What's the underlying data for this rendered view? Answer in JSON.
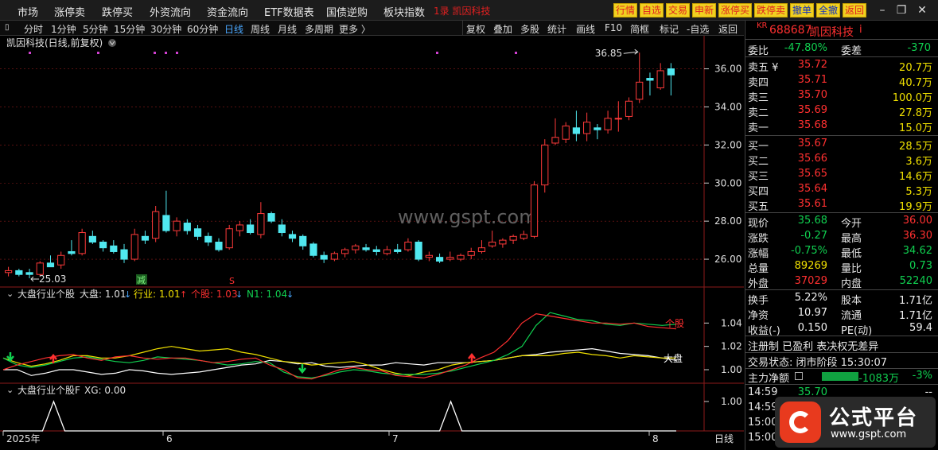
{
  "menu": {
    "items": [
      "市场",
      "涨停卖",
      "跌停买",
      "外资流向",
      "资金流向",
      "ETF数据表",
      "国债逆购",
      "板块指数"
    ],
    "stock_tag": "1录 凯因科技",
    "toolbar_buttons": [
      "行情",
      "自选",
      "交易",
      "申新",
      "涨停买",
      "跌停卖",
      "撤单",
      "全撤",
      "返回"
    ]
  },
  "period_bar": {
    "left_items": [
      "分时",
      "1分钟",
      "5分钟",
      "15分钟",
      "30分钟",
      "60分钟",
      "日线",
      "周线",
      "月线",
      "多周期",
      "更多 〉"
    ],
    "active": "日线",
    "right_items": [
      "复权",
      "叠加",
      "多股",
      "统计",
      "画线",
      "F10",
      "简框",
      "标记",
      "-自选",
      "返回"
    ]
  },
  "chart": {
    "main_title": "凯因科技(日线,前复权)",
    "price_ticks": [
      "36.00",
      "34.00",
      "32.00",
      "30.00",
      "28.00",
      "26.00"
    ],
    "high_label": "36.85",
    "low_label": "25.03",
    "watermark": "www.gspt.com",
    "sub1_title": "大盘行业个股",
    "sub1_values": {
      "dapan": "大盘: 1.01",
      "hangye": "行业: 1.01",
      "gegu": "个股: 1.03",
      "n1": "N1: 1.04"
    },
    "sub1_ticks": [
      "1.04",
      "1.02",
      "1.00"
    ],
    "sub1_tag_gegu": "个股",
    "sub1_tag_dapan": "大盘",
    "sub1_marker_jian": "减",
    "sub1_marker_s": "S",
    "sub2_title": "大盘行业个股F",
    "sub2_value": "XG: 0.00",
    "sub2_ticks": [
      "1.00"
    ],
    "x_labels": [
      "2025年",
      "6",
      "7",
      "8"
    ],
    "x_mode": "日线",
    "colors": {
      "up": "#ff3a3a",
      "down": "#50e8f0",
      "dapan": "#ffffff",
      "hangye": "#f0e000",
      "gegu": "#ff3030",
      "n1": "#10d050"
    }
  },
  "chart_data": {
    "type": "candlestick",
    "ylim": [
      25.0,
      36.9
    ],
    "candles": [
      {
        "o": 25.3,
        "h": 25.6,
        "l": 25.1,
        "c": 25.4
      },
      {
        "o": 25.4,
        "h": 25.5,
        "l": 25.1,
        "c": 25.2
      },
      {
        "o": 25.3,
        "h": 25.5,
        "l": 25.0,
        "c": 25.2
      },
      {
        "o": 25.2,
        "h": 25.9,
        "l": 25.1,
        "c": 25.8
      },
      {
        "o": 25.8,
        "h": 26.2,
        "l": 25.6,
        "c": 25.6
      },
      {
        "o": 25.7,
        "h": 26.4,
        "l": 25.5,
        "c": 26.2
      },
      {
        "o": 26.4,
        "h": 27.0,
        "l": 26.2,
        "c": 26.3
      },
      {
        "o": 26.3,
        "h": 27.6,
        "l": 26.2,
        "c": 27.4
      },
      {
        "o": 27.2,
        "h": 27.5,
        "l": 26.8,
        "c": 26.9
      },
      {
        "o": 26.9,
        "h": 27.0,
        "l": 26.4,
        "c": 26.6
      },
      {
        "o": 26.7,
        "h": 27.0,
        "l": 26.3,
        "c": 26.4
      },
      {
        "o": 26.5,
        "h": 26.8,
        "l": 25.8,
        "c": 26.0
      },
      {
        "o": 26.0,
        "h": 27.6,
        "l": 25.9,
        "c": 27.3
      },
      {
        "o": 27.2,
        "h": 27.5,
        "l": 26.8,
        "c": 27.0
      },
      {
        "o": 27.1,
        "h": 28.8,
        "l": 26.9,
        "c": 28.5
      },
      {
        "o": 28.3,
        "h": 29.6,
        "l": 27.4,
        "c": 27.5
      },
      {
        "o": 27.5,
        "h": 28.2,
        "l": 27.2,
        "c": 28.0
      },
      {
        "o": 27.9,
        "h": 28.1,
        "l": 27.3,
        "c": 27.5
      },
      {
        "o": 27.6,
        "h": 27.8,
        "l": 27.0,
        "c": 27.2
      },
      {
        "o": 27.2,
        "h": 27.4,
        "l": 26.7,
        "c": 26.9
      },
      {
        "o": 26.9,
        "h": 27.1,
        "l": 26.4,
        "c": 26.5
      },
      {
        "o": 26.6,
        "h": 27.8,
        "l": 26.5,
        "c": 27.6
      },
      {
        "o": 27.5,
        "h": 28.0,
        "l": 27.2,
        "c": 27.8
      },
      {
        "o": 27.8,
        "h": 28.1,
        "l": 27.3,
        "c": 27.4
      },
      {
        "o": 27.3,
        "h": 29.0,
        "l": 27.1,
        "c": 28.4
      },
      {
        "o": 28.4,
        "h": 28.5,
        "l": 27.9,
        "c": 28.0
      },
      {
        "o": 27.8,
        "h": 28.1,
        "l": 27.2,
        "c": 27.4
      },
      {
        "o": 27.3,
        "h": 27.5,
        "l": 26.9,
        "c": 27.1
      },
      {
        "o": 27.2,
        "h": 27.3,
        "l": 26.5,
        "c": 26.7
      },
      {
        "o": 26.8,
        "h": 26.9,
        "l": 26.1,
        "c": 26.2
      },
      {
        "o": 26.2,
        "h": 26.4,
        "l": 25.8,
        "c": 26.0
      },
      {
        "o": 26.0,
        "h": 26.4,
        "l": 25.9,
        "c": 26.3
      },
      {
        "o": 26.3,
        "h": 26.6,
        "l": 26.1,
        "c": 26.5
      },
      {
        "o": 26.5,
        "h": 26.8,
        "l": 26.3,
        "c": 26.7
      },
      {
        "o": 26.6,
        "h": 26.8,
        "l": 26.4,
        "c": 26.5
      },
      {
        "o": 26.5,
        "h": 26.7,
        "l": 26.2,
        "c": 26.4
      },
      {
        "o": 26.3,
        "h": 26.7,
        "l": 26.2,
        "c": 26.5
      },
      {
        "o": 26.5,
        "h": 26.8,
        "l": 26.3,
        "c": 26.4
      },
      {
        "o": 26.5,
        "h": 27.1,
        "l": 26.4,
        "c": 26.9
      },
      {
        "o": 26.9,
        "h": 27.0,
        "l": 25.9,
        "c": 26.0
      },
      {
        "o": 26.1,
        "h": 26.4,
        "l": 25.9,
        "c": 26.2
      },
      {
        "o": 26.1,
        "h": 26.3,
        "l": 25.8,
        "c": 25.9
      },
      {
        "o": 26.0,
        "h": 26.4,
        "l": 25.9,
        "c": 26.1
      },
      {
        "o": 26.0,
        "h": 26.3,
        "l": 25.9,
        "c": 26.2
      },
      {
        "o": 26.2,
        "h": 26.6,
        "l": 26.0,
        "c": 26.4
      },
      {
        "o": 26.4,
        "h": 27.0,
        "l": 26.3,
        "c": 26.6
      },
      {
        "o": 26.7,
        "h": 27.5,
        "l": 26.6,
        "c": 26.9
      },
      {
        "o": 26.8,
        "h": 27.1,
        "l": 26.6,
        "c": 27.0
      },
      {
        "o": 27.0,
        "h": 27.3,
        "l": 26.8,
        "c": 27.2
      },
      {
        "o": 27.1,
        "h": 27.5,
        "l": 27.0,
        "c": 27.3
      },
      {
        "o": 27.2,
        "h": 30.1,
        "l": 27.1,
        "c": 29.9
      },
      {
        "o": 29.9,
        "h": 32.3,
        "l": 29.5,
        "c": 32.0
      },
      {
        "o": 32.1,
        "h": 33.4,
        "l": 32.0,
        "c": 32.4
      },
      {
        "o": 32.3,
        "h": 33.2,
        "l": 32.1,
        "c": 33.0
      },
      {
        "o": 32.9,
        "h": 33.8,
        "l": 32.2,
        "c": 32.6
      },
      {
        "o": 32.6,
        "h": 33.7,
        "l": 32.2,
        "c": 33.2
      },
      {
        "o": 32.9,
        "h": 33.1,
        "l": 32.3,
        "c": 32.8
      },
      {
        "o": 32.8,
        "h": 33.8,
        "l": 32.6,
        "c": 33.4
      },
      {
        "o": 33.4,
        "h": 34.3,
        "l": 32.7,
        "c": 33.4
      },
      {
        "o": 33.5,
        "h": 34.5,
        "l": 33.3,
        "c": 34.3
      },
      {
        "o": 34.4,
        "h": 36.85,
        "l": 34.2,
        "c": 35.3
      },
      {
        "o": 35.5,
        "h": 35.8,
        "l": 34.6,
        "c": 35.4
      },
      {
        "o": 35.0,
        "h": 36.3,
        "l": 34.9,
        "c": 35.9
      },
      {
        "o": 36.0,
        "h": 36.3,
        "l": 34.6,
        "c": 35.68
      }
    ],
    "indicator": {
      "ylim": [
        0.985,
        1.06
      ],
      "dapan": [
        1.0,
        1.0,
        0.995,
        0.997,
        1.0,
        1.0,
        0.998,
        0.996,
        0.997,
        1.0,
        0.999,
        0.997,
        0.996,
        0.997,
        0.998,
        1.0,
        1.002,
        1.004,
        1.005,
        1.008,
        1.007,
        1.005,
        1.006,
        1.003,
        1.002,
        1.003,
        1.004,
        1.004,
        1.006,
        1.005,
        1.004,
        1.006,
        1.006,
        1.006,
        1.007,
        1.008,
        1.01,
        1.012,
        1.013,
        1.015,
        1.016,
        1.017,
        1.018,
        1.016,
        1.014,
        1.013,
        1.012,
        1.01,
        1.008
      ],
      "hangye": [
        1.01,
        1.006,
        1.003,
        1.005,
        1.008,
        1.012,
        1.012,
        1.01,
        1.01,
        1.012,
        1.015,
        1.018,
        1.02,
        1.018,
        1.016,
        1.017,
        1.018,
        1.015,
        1.013,
        1.01,
        1.007,
        1.006,
        1.004,
        1.005,
        1.006,
        1.007,
        1.004,
        1.0,
        0.997,
        0.995,
        0.998,
        1.0,
        1.004,
        1.006,
        1.007,
        1.008,
        1.01,
        1.012,
        1.012,
        1.012,
        1.014,
        1.015,
        1.013,
        1.012,
        1.01,
        1.012,
        1.011,
        1.01,
        1.01
      ],
      "gegu": [
        1.0,
        1.004,
        1.007,
        1.01,
        1.012,
        1.013,
        1.01,
        1.008,
        1.011,
        1.012,
        1.01,
        1.009,
        1.01,
        1.01,
        1.008,
        1.006,
        1.007,
        1.009,
        1.01,
        1.004,
        1.0,
        0.993,
        0.992,
        0.996,
        1.0,
        1.002,
        1.0,
        0.999,
        0.995,
        0.994,
        0.993,
        0.996,
        1.0,
        1.004,
        1.01,
        1.015,
        1.025,
        1.04,
        1.048,
        1.046,
        1.044,
        1.042,
        1.04,
        1.04,
        1.039,
        1.04,
        1.037,
        1.036,
        1.035
      ],
      "n1": [
        1.01,
        1.004,
        1.002,
        1.004,
        1.007,
        1.01,
        1.011,
        1.009,
        1.007,
        1.006,
        1.008,
        1.011,
        1.01,
        1.009,
        1.008,
        1.006,
        1.004,
        1.005,
        1.007,
        1.006,
        0.998,
        0.994,
        0.993,
        0.995,
        0.998,
        1.0,
        0.999,
        0.997,
        0.996,
        0.996,
        0.996,
        0.997,
        0.999,
        1.002,
        1.005,
        1.008,
        1.013,
        1.02,
        1.038,
        1.049,
        1.046,
        1.043,
        1.042,
        1.039,
        1.038,
        1.04,
        1.039,
        1.038,
        1.039
      ]
    },
    "xg_spikes_at_fraction": [
      0.075,
      0.665
    ]
  },
  "rpanel": {
    "code": "688687",
    "name": "凯因科技",
    "kr": "KR",
    "weibi": {
      "label": "委比",
      "value": "-47.80%",
      "label2": "委差",
      "value2": "-370"
    },
    "sells": [
      {
        "label": "卖五 ¥",
        "price": "35.72",
        "vol": "20.7万"
      },
      {
        "label": "卖四",
        "price": "35.71",
        "vol": "40.7万"
      },
      {
        "label": "卖三",
        "price": "35.70",
        "vol": "100.0万"
      },
      {
        "label": "卖二",
        "price": "35.69",
        "vol": "27.8万"
      },
      {
        "label": "卖一",
        "price": "35.68",
        "vol": "15.0万"
      }
    ],
    "buys": [
      {
        "label": "买一",
        "price": "35.67",
        "vol": "28.5万"
      },
      {
        "label": "买二",
        "price": "35.66",
        "vol": "3.6万"
      },
      {
        "label": "买三",
        "price": "35.65",
        "vol": "14.6万"
      },
      {
        "label": "买四",
        "price": "35.64",
        "vol": "5.3万"
      },
      {
        "label": "买五",
        "price": "35.61",
        "vol": "19.9万"
      }
    ],
    "stats": [
      {
        "l1": "现价",
        "v1": "35.68",
        "c1": "green",
        "l2": "今开",
        "v2": "36.00",
        "c2": "red"
      },
      {
        "l1": "涨跌",
        "v1": "-0.27",
        "c1": "green",
        "l2": "最高",
        "v2": "36.30",
        "c2": "red"
      },
      {
        "l1": "涨幅",
        "v1": "-0.75%",
        "c1": "green",
        "l2": "最低",
        "v2": "34.62",
        "c2": "green"
      },
      {
        "l1": "总量",
        "v1": "89269",
        "c1": "yellow",
        "l2": "量比",
        "v2": "0.73",
        "c2": "green"
      },
      {
        "l1": "外盘",
        "v1": "37029",
        "c1": "red",
        "l2": "内盘",
        "v2": "52240",
        "c2": "green"
      }
    ],
    "fund": [
      {
        "l1": "换手",
        "v1": "5.22%",
        "l2": "股本",
        "v2": "1.71亿"
      },
      {
        "l1": "净资",
        "v1": "10.97",
        "l2": "流通",
        "v2": "1.71亿"
      },
      {
        "l1": "收益(-)",
        "v1": "0.150",
        "l2": "PE(动)",
        "v2": "59.4"
      }
    ],
    "reg": "注册制 已盈利 表决权无差异",
    "trade_status": "交易状态: 闭市阶段 15:30:07",
    "main_flow": {
      "label": "主力净额",
      "value": "-1083万",
      "pct": "-3%"
    },
    "ticks": [
      {
        "time": "14:59",
        "price": "35.70",
        "vol": "--"
      },
      {
        "time": "14:59",
        "price": "",
        "vol": ""
      },
      {
        "time": "15:00",
        "price": "",
        "vol": ""
      },
      {
        "time": "15:00",
        "price": "",
        "vol": ""
      }
    ]
  },
  "logo": {
    "title": "公式平台",
    "url": "www.gspt.com"
  }
}
